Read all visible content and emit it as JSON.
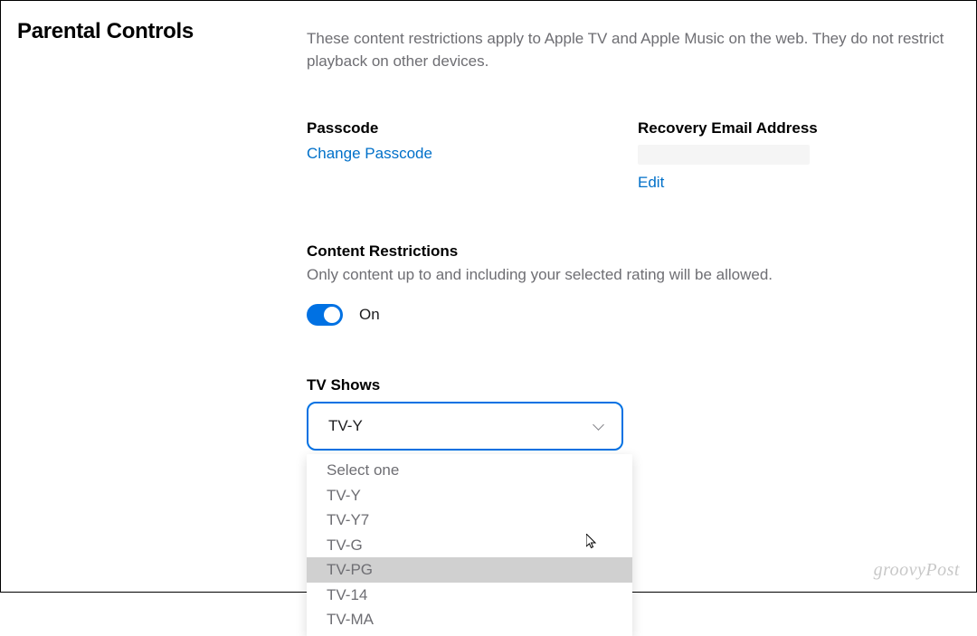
{
  "page_title": "Parental Controls",
  "description": "These content restrictions apply to Apple TV and Apple Music on the web. They do not restrict playback on other devices.",
  "passcode": {
    "label": "Passcode",
    "change_link": "Change Passcode"
  },
  "recovery_email": {
    "label": "Recovery Email Address",
    "edit_link": "Edit"
  },
  "content_restrictions": {
    "title": "Content Restrictions",
    "description": "Only content up to and including your selected rating will be allowed.",
    "toggle_state": "On"
  },
  "tv_shows": {
    "label": "TV Shows",
    "selected": "TV-Y",
    "options": [
      "Select one",
      "TV-Y",
      "TV-Y7",
      "TV-G",
      "TV-PG",
      "TV-14",
      "TV-MA"
    ],
    "highlighted_index": 4
  },
  "watermark": "groovyPost"
}
